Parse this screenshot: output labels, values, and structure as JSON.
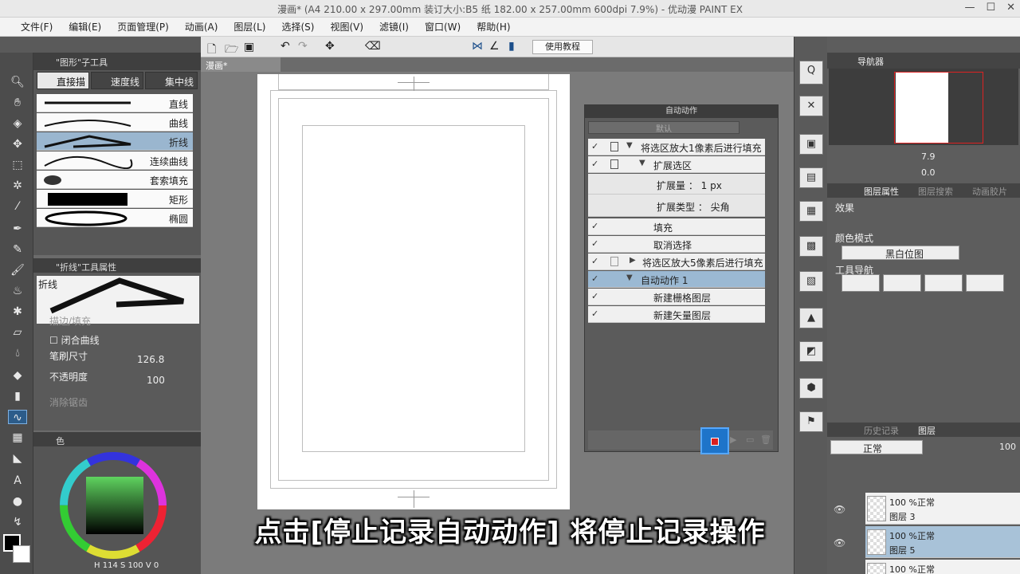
{
  "window": {
    "title": "漫画* (A4 210.00 x 297.00mm 装订大小:B5 纸 182.00 x 257.00mm 600dpi 7.9%) - 优动漫 PAINT EX"
  },
  "menu": [
    "文件(F)",
    "编辑(E)",
    "页面管理(P)",
    "动画(A)",
    "图层(L)",
    "选择(S)",
    "视图(V)",
    "滤镜(I)",
    "窗口(W)",
    "帮助(H)"
  ],
  "toolbar": {
    "tutorial_label": "使用教程"
  },
  "document": {
    "tab_label": "漫画*"
  },
  "subtool": {
    "header": "\"图形\"子工具",
    "tabs": [
      "直接描",
      "速度线",
      "集中线"
    ],
    "items": [
      "直线",
      "曲线",
      "折线",
      "连续曲线",
      "套索填充",
      "矩形",
      "椭圆"
    ]
  },
  "tool_property": {
    "header": "\"折线\"工具属性",
    "preview_label": "折线",
    "edge_fill": "描边/填充",
    "closed_curve": "闭合曲线",
    "brush_size_label": "笔刷尺寸",
    "brush_size_value": "126.8",
    "opacity_label": "不透明度",
    "opacity_value": "100",
    "antialias_label": "消除锯齿"
  },
  "color": {
    "header": "色",
    "h_label": "H",
    "h_value": "114",
    "s_label": "S",
    "s_value": "100",
    "v_label": "V",
    "v_value": "0"
  },
  "auto_action": {
    "header": "自动动作",
    "set_name": "默认",
    "rows": [
      {
        "label": "将选区放大1像素后进行填充",
        "checked": true
      },
      {
        "label": "扩展选区",
        "checked": true
      },
      {
        "label": "扩展量 ： 1 px",
        "checked": false
      },
      {
        "label": "扩展类型 ： 尖角",
        "checked": false
      },
      {
        "label": "填充",
        "checked": true
      },
      {
        "label": "取消选择",
        "checked": true
      },
      {
        "label": "将选区放大5像素后进行填充",
        "checked": true
      },
      {
        "label": "自动动作 1",
        "checked": true
      },
      {
        "label": "新建栅格图层",
        "checked": true
      },
      {
        "label": "新建矢量图层",
        "checked": true
      }
    ]
  },
  "navigator": {
    "tab_label": "导航器",
    "zoom_value": "7.9",
    "rotate_value": "0.0"
  },
  "layer_property": {
    "tabs": [
      "图层属性",
      "图层搜索",
      "动画胶片"
    ],
    "effect_label": "效果",
    "color_mode_label": "颜色模式",
    "color_mode_value": "黑白位图",
    "tool_nav_label": "工具导航"
  },
  "layers": {
    "tabs": [
      "历史记录",
      "图层"
    ],
    "blend_mode": "正常",
    "opacity": "100",
    "items": [
      {
        "line1": "100 %正常",
        "line2": "图层 3"
      },
      {
        "line1": "100 %正常",
        "line2": "图层 5"
      },
      {
        "line1": "100 %正常",
        "line2": ""
      }
    ]
  },
  "caption": "点击[停止记录自动动作] 将停止记录操作",
  "colors": {
    "accent": "#1e74c9",
    "selection": "#9bb9d3",
    "stop": "#d81f1f"
  }
}
